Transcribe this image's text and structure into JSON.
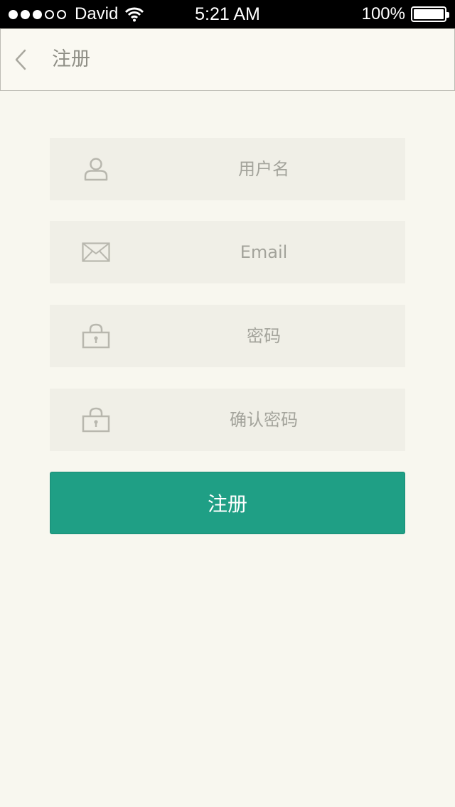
{
  "status_bar": {
    "carrier": "David",
    "time": "5:21 AM",
    "battery": "100%",
    "battery_level": 1.0,
    "signal_dots_filled": 3,
    "signal_dots_total": 5
  },
  "nav": {
    "title": "注册",
    "back_icon": "chevron-left-icon"
  },
  "form": {
    "fields": [
      {
        "placeholder": "用户名",
        "icon": "user-icon",
        "type": "text"
      },
      {
        "placeholder": "Email",
        "icon": "envelope-icon",
        "type": "email"
      },
      {
        "placeholder": "密码",
        "icon": "lock-icon",
        "type": "password"
      },
      {
        "placeholder": "确认密码",
        "icon": "lock-icon",
        "type": "password"
      }
    ],
    "submit_label": "注册"
  },
  "colors": {
    "background": "#f8f7ef",
    "field_background": "#f0efe7",
    "accent": "#1f9f85",
    "icon": "#b8b7ae"
  }
}
